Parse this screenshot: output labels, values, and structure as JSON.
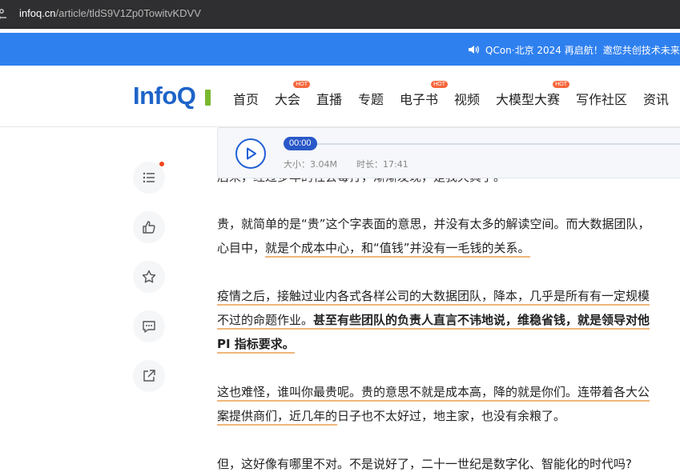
{
  "browser": {
    "url_host": "infoq.cn",
    "url_path": "/article/tldS9V1Zp0TowitvKDVV"
  },
  "announcement": {
    "text": "QCon·北京 2024 再启航！邀您共创技术未来"
  },
  "nav": {
    "logo": "InfoQ",
    "items": [
      {
        "label": "首页"
      },
      {
        "label": "大会",
        "badge": "HOT"
      },
      {
        "label": "直播"
      },
      {
        "label": "专题"
      },
      {
        "label": "电子书",
        "badge": "HOT"
      },
      {
        "label": "视频"
      },
      {
        "label": "大模型大赛",
        "badge": "HOT"
      },
      {
        "label": "写作社区"
      },
      {
        "label": "资讯"
      }
    ]
  },
  "tools": [
    "list-icon",
    "thumbs-up-icon",
    "star-icon",
    "comment-icon",
    "share-icon"
  ],
  "player": {
    "time": "00:00",
    "size_label": "大小：3.04M",
    "duration_label": "时长：17:41",
    "progress": 0
  },
  "article": {
    "cut_line": "后来，经过多年的社会毒打，渐渐发现，是我天真了。",
    "p1_l1": "贵，就简单的是“贵”这个字表面的意思，并没有太多的解读空间。而大数据团队，",
    "p1_l2_a": "心目中，",
    "p1_l2_b": "就是个成本中心，和“值钱”并没有一毛钱的关系。",
    "p2_l1": "疫情之后，接触过业内各式各样公司的大数据团队，降本，几乎是所有有一定规模",
    "p2_l2_a": "不过的命题作业。",
    "p2_l2_b": "甚至有些团队的负责人直言不讳地说，维稳省钱，就是领导对他",
    "p2_l3": "PI 指标要求。",
    "p3_l1": "这也难怪，谁叫你最贵呢。贵的意思不就是成本高，降的就是你们。连带着各大公",
    "p3_l2_a": "案提供商们，近几年的",
    "p3_l2_b": "日子也不太好过，地主家，也没有余粮了。",
    "p4_l1": "但，这好像有哪里不对。不是说好了，二十一世纪是数字化、智能化的时代吗?"
  }
}
